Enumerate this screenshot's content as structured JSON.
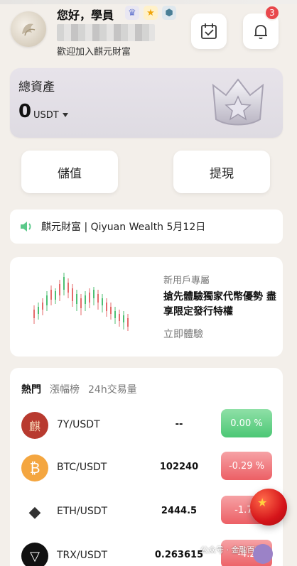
{
  "header": {
    "greeting": "您好，學員",
    "welcome": "歡迎加入麒元財富",
    "notification_count": "3",
    "badges": [
      "crown-badge",
      "star-badge",
      "gem-badge"
    ]
  },
  "assets": {
    "label": "總資產",
    "amount": "0",
    "unit": "USDT"
  },
  "actions": {
    "deposit": "儲值",
    "withdraw": "提現"
  },
  "announcement": {
    "text": "麒元財富 | Qiyuan Wealth 5月12日"
  },
  "promo": {
    "tag": "新用戶專屬",
    "title": "搶先體驗獨家代幣優勢 盡享限定發行特權",
    "cta": "立即體驗"
  },
  "market": {
    "tabs": [
      "熱門",
      "漲幅榜",
      "24h交易量"
    ],
    "rows": [
      {
        "pair": "7Y/USDT",
        "price": "--",
        "change": "0.00 %",
        "dir": "up",
        "icon": "7y-logo-icon",
        "icon_char": "麒"
      },
      {
        "pair": "BTC/USDT",
        "price": "102240",
        "change": "-0.29 %",
        "dir": "down",
        "icon": "bitcoin-icon",
        "icon_char": "₿"
      },
      {
        "pair": "ETH/USDT",
        "price": "2444.5",
        "change": "-1.70",
        "dir": "down",
        "icon": "ethereum-icon",
        "icon_char": "◆"
      },
      {
        "pair": "TRX/USDT",
        "price": "0.263615",
        "change": "-4.2",
        "dir": "down",
        "icon": "tron-icon",
        "icon_char": "▽"
      }
    ]
  },
  "watermark": {
    "text": "公众号 · 金融百家"
  },
  "colors": {
    "up": "#4cc775",
    "down": "#ec5f65",
    "notification": "#e8474b"
  }
}
